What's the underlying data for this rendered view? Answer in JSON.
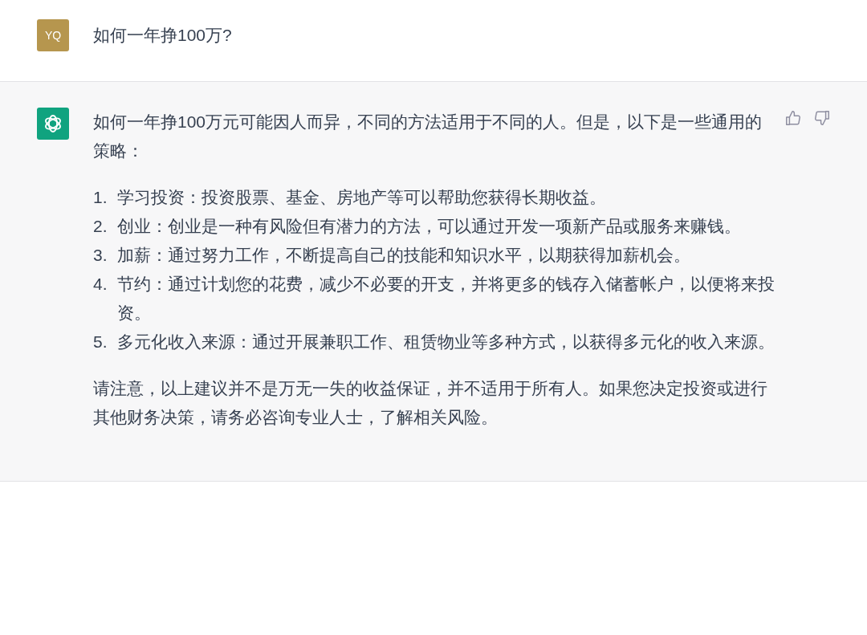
{
  "messages": [
    {
      "kind": "user",
      "avatar": "YQ",
      "text": "如何一年挣100万?"
    },
    {
      "kind": "assistant",
      "intro": "如何一年挣100万元可能因人而异，不同的方法适用于不同的人。但是，以下是一些通用的策略：",
      "items": [
        {
          "number": "1.",
          "text": "学习投资：投资股票、基金、房地产等可以帮助您获得长期收益。"
        },
        {
          "number": "2.",
          "text": "创业：创业是一种有风险但有潜力的方法，可以通过开发一项新产品或服务来赚钱。"
        },
        {
          "number": "3.",
          "text": "加薪：通过努力工作，不断提高自己的技能和知识水平，以期获得加薪机会。"
        },
        {
          "number": "4.",
          "text": "节约：通过计划您的花费，减少不必要的开支，并将更多的钱存入储蓄帐户，以便将来投资。"
        },
        {
          "number": "5.",
          "text": "多元化收入来源：通过开展兼职工作、租赁物业等多种方式，以获得多元化的收入来源。"
        }
      ],
      "note": "请注意，以上建议并不是万无一失的收益保证，并不适用于所有人。如果您决定投资或进行其他财务决策，请务必咨询专业人士，了解相关风险。"
    }
  ]
}
